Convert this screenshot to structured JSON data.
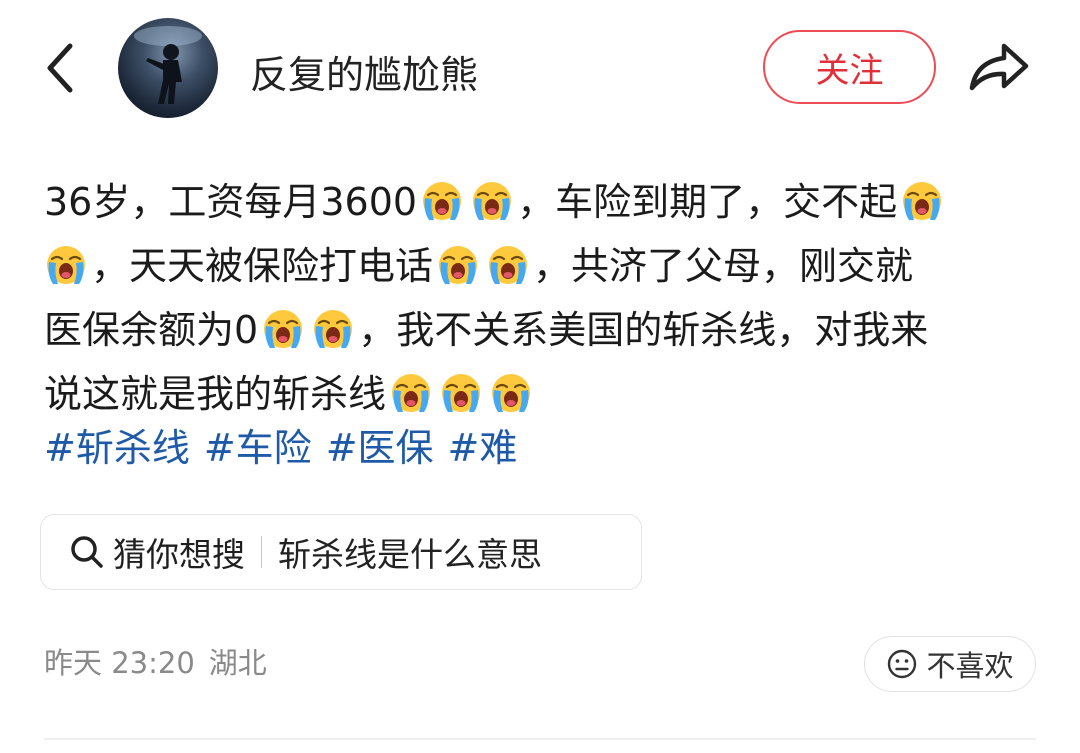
{
  "header": {
    "username": "反复的尴尬熊",
    "follow_label": "关注"
  },
  "post": {
    "segments_line1": [
      "36岁，工资每月3600",
      "，车险到期了，交不起"
    ],
    "segments_line2": [
      "，天天被保险打电话",
      "，共济了父母，刚交就"
    ],
    "segments_line3": [
      "医保余额为0",
      "，我不关系美国的斩杀线，对我来"
    ],
    "segments_line4": [
      "说这就是我的斩杀线"
    ],
    "emoji_name": "loudly-crying-face"
  },
  "tags": [
    "#斩杀线",
    "#车险",
    "#医保",
    "#难"
  ],
  "guess_search": {
    "label": "猜你想搜",
    "query": "斩杀线是什么意思"
  },
  "meta": {
    "time": "昨天 23:20",
    "location": "湖北"
  },
  "dislike_label": "不喜欢",
  "colors": {
    "accent_red": "#e0313b",
    "tag_blue": "#1f5aa8",
    "meta_gray": "#8a8a8a"
  }
}
